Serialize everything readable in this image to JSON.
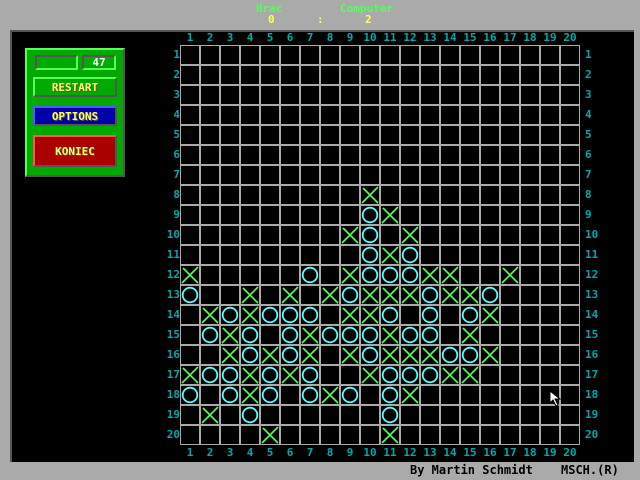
{
  "header": {
    "player_label": "Hrac",
    "computer_label": "Computer",
    "player_score": "0",
    "separator": ":",
    "computer_score": "2"
  },
  "panel": {
    "counter": "47",
    "restart": "RESTART",
    "options": "OPTIONS",
    "quit": "KONIEC"
  },
  "board": {
    "size": 20,
    "rows": [
      "....................",
      "....................",
      "....................",
      "....................",
      "....................",
      "....................",
      "....................",
      ".........X..........",
      ".........OX.........",
      "........XO.X........",
      ".........OXO........",
      "X.....O.XOOOXX..X...",
      "O..X.X.XOXXXOXXO....",
      ".XOXOOO.XXO.O.OX....",
      ".OXO.OXOOOXOO.X.....",
      "..XOXOX.XOXXXOOX....",
      "XOOXOXO..XOOOXX.....",
      "O.OXO.OXO.OX........",
      ".X.O......O.........",
      "....X.....X........."
    ]
  },
  "colors": {
    "x": "#55ff55",
    "o": "#55ffff"
  },
  "footer": {
    "author": "By Martin Schmidt",
    "mark": "MSCH.(R)"
  }
}
